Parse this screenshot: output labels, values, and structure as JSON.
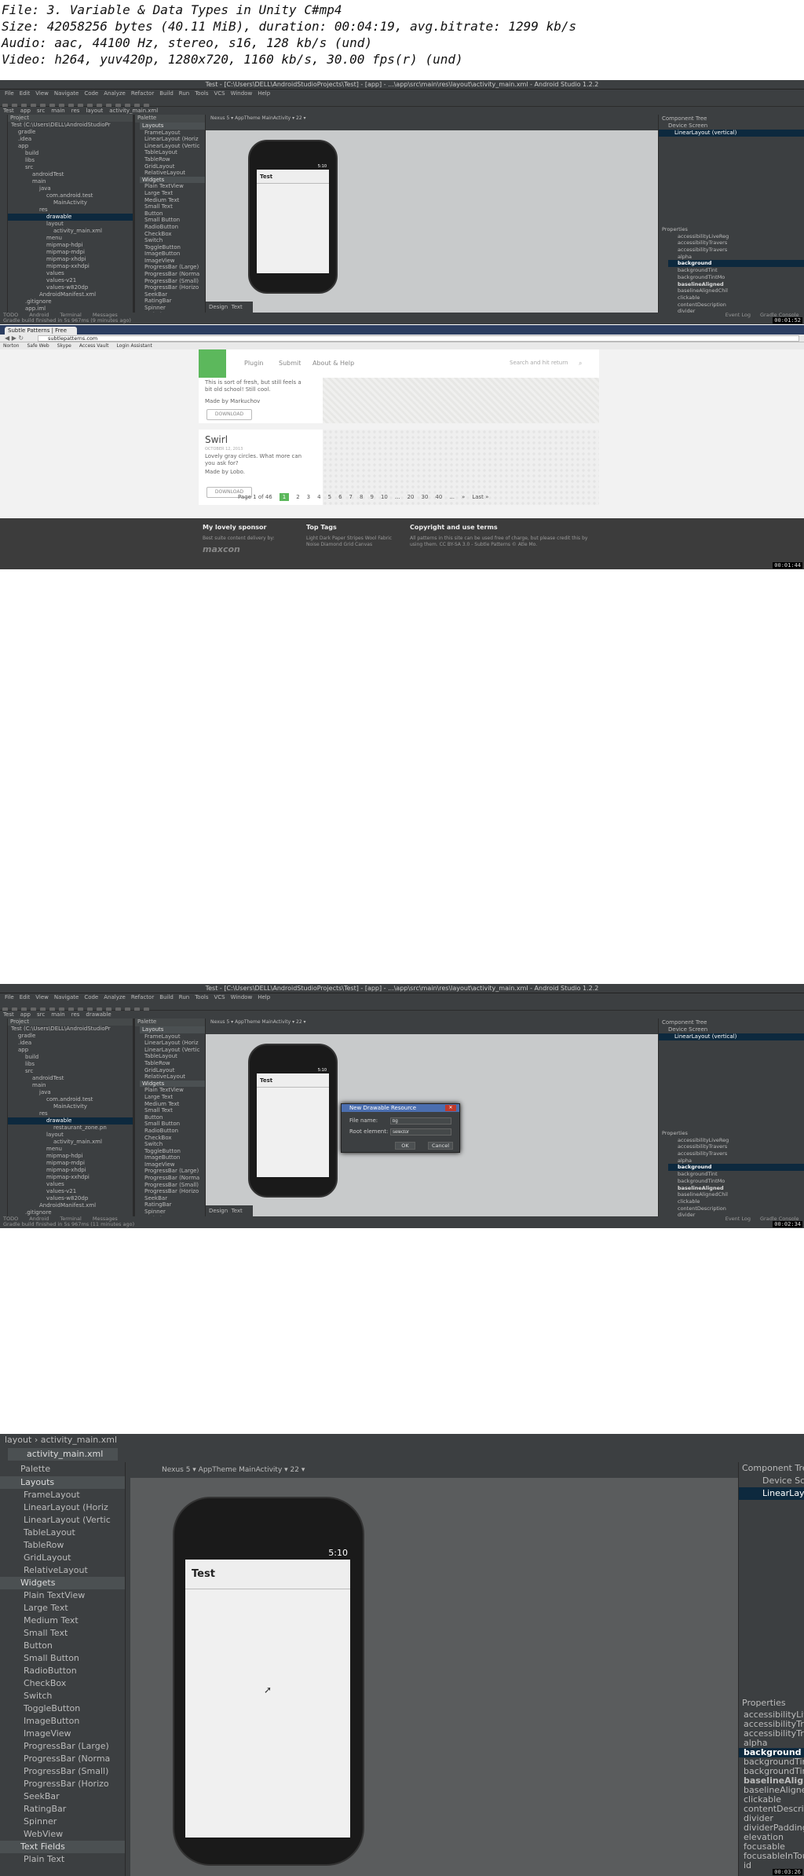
{
  "header": {
    "file": "File: 3. Variable & Data Types in Unity C#mp4",
    "size": "Size: 42058256 bytes (40.11 MiB), duration: 00:04:19, avg.bitrate: 1299 kb/s",
    "audio": "Audio: aac, 44100 Hz, stereo, s16, 128 kb/s (und)",
    "video": "Video: h264, yuv420p, 1280x720, 1160 kb/s, 30.00 fps(r) (und)"
  },
  "studio": {
    "title": "Test - [C:\\Users\\DELL\\AndroidStudioProjects\\Test] - [app] - ...\\app\\src\\main\\res\\layout\\activity_main.xml - Android Studio 1.2.2",
    "menu": [
      "File",
      "Edit",
      "View",
      "Navigate",
      "Code",
      "Analyze",
      "Refactor",
      "Build",
      "Run",
      "Tools",
      "VCS",
      "Window",
      "Help"
    ],
    "breadcrumb1": [
      "Test",
      "app",
      "src",
      "main",
      "res",
      "layout",
      "activity_main.xml"
    ],
    "breadcrumb3": [
      "Test",
      "app",
      "src",
      "main",
      "res",
      "drawable"
    ],
    "file_tab": "activity_main.xml",
    "project_header": "Project",
    "tree1": [
      "Test (C:\\Users\\DELL\\AndroidStudioPr",
      "gradle",
      ".idea",
      "app",
      "build",
      "libs",
      "src",
      "androidTest",
      "main",
      "java",
      "com.android.test",
      "MainActivity",
      "res",
      "drawable",
      "layout",
      "activity_main.xml",
      "menu",
      "mipmap-hdpi",
      "mipmap-mdpi",
      "mipmap-xhdpi",
      "mipmap-xxhdpi",
      "values",
      "values-v21",
      "values-w820dp",
      "AndroidManifest.xml",
      ".gitignore",
      "app.iml",
      "build.gradle",
      "proguard-rules.pro",
      "build",
      ".gitignore",
      "build.gradle"
    ],
    "tree3": [
      "Test (C:\\Users\\DELL\\AndroidStudioPr",
      "gradle",
      ".idea",
      "app",
      "build",
      "libs",
      "src",
      "androidTest",
      "main",
      "java",
      "com.android.test",
      "MainActivity",
      "res",
      "drawable",
      "restaurant_zone.pn",
      "layout",
      "activity_main.xml",
      "menu",
      "mipmap-hdpi",
      "mipmap-mdpi",
      "mipmap-xhdpi",
      "mipmap-xxhdpi",
      "values",
      "values-v21",
      "values-w820dp",
      "AndroidManifest.xml",
      ".gitignore",
      "app.iml",
      "build.gradle",
      "proguard-rules.pro",
      "build",
      "gradle",
      ".gitignore"
    ],
    "palette_header": "Palette",
    "palette": [
      {
        "cat": true,
        "label": "Layouts"
      },
      {
        "label": "FrameLayout"
      },
      {
        "label": "LinearLayout (Horiz"
      },
      {
        "label": "LinearLayout (Vertic"
      },
      {
        "label": "TableLayout"
      },
      {
        "label": "TableRow"
      },
      {
        "label": "GridLayout"
      },
      {
        "label": "RelativeLayout"
      },
      {
        "cat": true,
        "label": "Widgets"
      },
      {
        "label": "Plain TextView"
      },
      {
        "label": "Large Text"
      },
      {
        "label": "Medium Text"
      },
      {
        "label": "Small Text"
      },
      {
        "label": "Button"
      },
      {
        "label": "Small Button"
      },
      {
        "label": "RadioButton"
      },
      {
        "label": "CheckBox"
      },
      {
        "label": "Switch"
      },
      {
        "label": "ToggleButton"
      },
      {
        "label": "ImageButton"
      },
      {
        "label": "ImageView"
      },
      {
        "label": "ProgressBar (Large)"
      },
      {
        "label": "ProgressBar (Norma"
      },
      {
        "label": "ProgressBar (Small)"
      },
      {
        "label": "ProgressBar (Horizo"
      },
      {
        "label": "SeekBar"
      },
      {
        "label": "RatingBar"
      },
      {
        "label": "Spinner"
      },
      {
        "label": "WebView"
      },
      {
        "cat": true,
        "label": "Text Fields"
      },
      {
        "label": "Plain Text"
      }
    ],
    "canvas_toolbar": "Nexus 5 ▾   AppTheme   MainActivity ▾   22 ▾",
    "app_title": "Test",
    "clock": "5:10",
    "component_tree_header": "Component Tree",
    "tree_device": "Device Screen",
    "tree_layout": "LinearLayout (vertical)",
    "properties_header": "Properties",
    "properties": [
      "accessibilityLiveReg",
      "accessibilityTravers",
      "accessibilityTravers",
      "alpha",
      "background",
      "backgroundTint",
      "backgroundTintMo",
      "baselineAligned",
      "baselineAlignedChil",
      "clickable",
      "contentDescription",
      "divider",
      "dividerPadding",
      "elevation",
      "focusable",
      "focusableInTouchM",
      "id"
    ],
    "design_tab": "Design",
    "text_tab": "Text",
    "bottom_tabs": [
      "TODO",
      "Android",
      "Terminal",
      "Messages"
    ],
    "event_log": "Event Log",
    "gradle_console": "Gradle Console",
    "status1": "Gradle build finished in 5s 967ms (9 minutes ago)",
    "status3": "Gradle build finished in 5s 967ms (11 minutes ago)",
    "dialog": {
      "title": "New Drawable Resource",
      "file_label": "File name:",
      "file_value": "bg",
      "root_label": "Root element:",
      "root_value": "selector",
      "ok": "OK",
      "cancel": "Cancel"
    }
  },
  "browser": {
    "tab": "Subtle Patterns | Free",
    "url": "subtlepatterns.com",
    "bookmarks": [
      "Norton",
      "Safe Web",
      "Skype",
      "Access Vault",
      "Login Assistant"
    ],
    "nav": [
      "Plugin",
      "Submit",
      "About & Help"
    ],
    "search": "Search and hit return",
    "card1_text": "This is sort of fresh, but still feels a bit old school! Still cool.",
    "card1_made": "Made by Markuchov",
    "download": "DOWNLOAD",
    "card2_title": "Swirl",
    "card2_date": "OCTOBER 12, 2013",
    "card2_text": "Lovely gray circles. What more can you ask for?",
    "card2_made": "Made by Lobo.",
    "page_of": "Page 1 of 46",
    "pages": [
      "1",
      "2",
      "3",
      "4",
      "5",
      "6",
      "7",
      "8",
      "9",
      "10",
      "...",
      "20",
      "30",
      "40",
      "...",
      "»",
      "Last »"
    ],
    "footer_sponsor": "My lovely sponsor",
    "footer_sponsor_text": "Best suite content delivery by:",
    "footer_brand": "maxcon",
    "footer_tags": "Top Tags",
    "footer_tag_list": "Light  Dark  Paper  Stripes  Wool  Fabric  Noise  Diamond  Grid  Canvas",
    "footer_copy": "Copyright and use terms",
    "footer_copy_text": "All patterns in this site can be used free of charge, but please credit this by using them. CC BY-SA 3.0 - Subtle Patterns © Atle Mo."
  },
  "timestamps": [
    "00:01:52",
    "00:01:44",
    "00:02:34",
    "00:03:26"
  ]
}
